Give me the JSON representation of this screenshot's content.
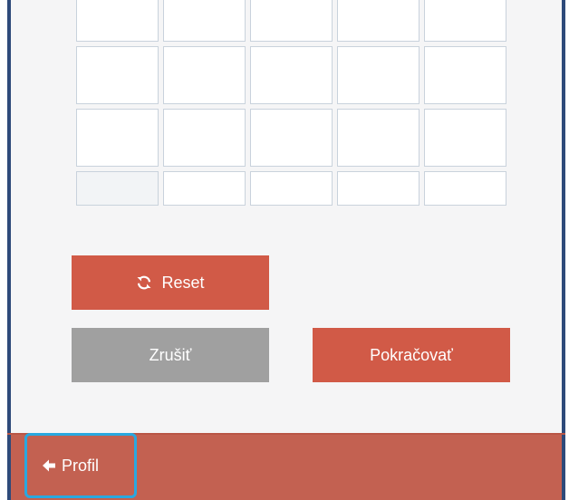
{
  "actions": {
    "reset_label": "Reset",
    "cancel_label": "Zrušiť",
    "continue_label": "Pokračovať"
  },
  "footer": {
    "back_label": "Profil"
  },
  "icons": {
    "reset": "refresh-icon",
    "back": "arrow-left-icon"
  },
  "colors": {
    "accent": "#d15a47",
    "cancel": "#a0a0a0",
    "frame": "#2e4a7a",
    "footer": "#c36151",
    "focus": "#29a8e0"
  }
}
